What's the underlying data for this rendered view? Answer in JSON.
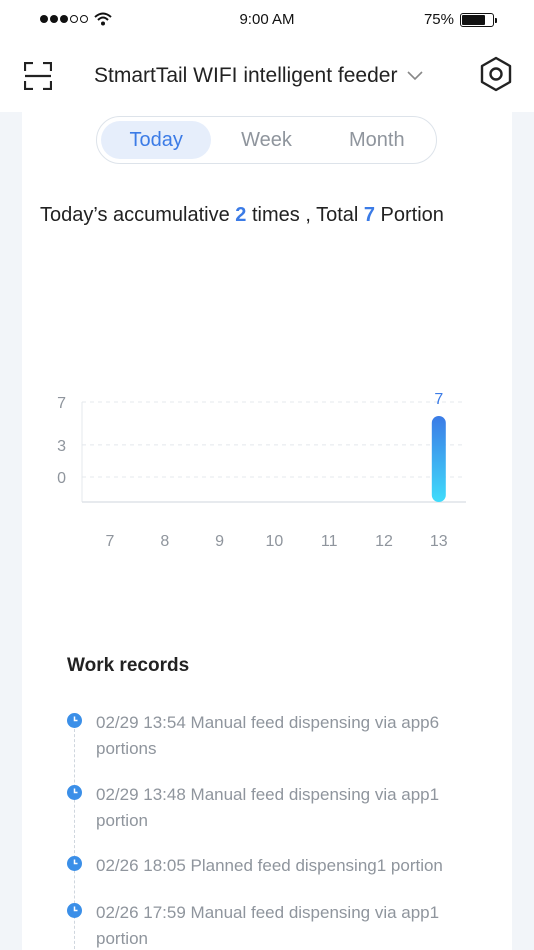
{
  "status_bar": {
    "time": "9:00 AM",
    "battery": "75%",
    "battery_level": 0.75
  },
  "header": {
    "title": "StmartTail WIFI intelligent feeder",
    "icons": [
      "scan-icon",
      "chevron-down-icon",
      "settings-icon"
    ]
  },
  "tabs": [
    {
      "label": "Today",
      "active": true
    },
    {
      "label": "Week",
      "active": false
    },
    {
      "label": "Month",
      "active": false
    }
  ],
  "summary": {
    "prefix": "Today’s accumulative ",
    "times": "2",
    "middle": " times , Total ",
    "portions": "7",
    "suffix": " Portion"
  },
  "chart_data": {
    "type": "bar",
    "categories": [
      "7",
      "8",
      "9",
      "10",
      "11",
      "12",
      "13"
    ],
    "values": [
      0,
      0,
      0,
      0,
      0,
      0,
      7
    ],
    "yticks": [
      0,
      3,
      7
    ],
    "ylim": [
      0,
      7
    ],
    "data_labels": [
      {
        "category": "13",
        "text": "7"
      }
    ],
    "title": "",
    "xlabel": "",
    "ylabel": "",
    "grid": true,
    "colors": {
      "bar_top": "#3b7be6",
      "bar_bottom": "#3fdcfb",
      "label": "#3b7be6",
      "axis_text": "#8f959d"
    }
  },
  "records": {
    "title": "Work records",
    "items": [
      {
        "text": "02/29 13:54 Manual feed dispensing via app6 portions"
      },
      {
        "text": "02/29 13:48 Manual feed dispensing via app1 portion"
      },
      {
        "text": "02/26 18:05 Planned feed dispensing1 portion"
      },
      {
        "text": "02/26 17:59 Manual feed dispensing via app1 portion"
      }
    ]
  },
  "colors": {
    "accent": "#3b7be6",
    "page_bg": "#f2f5f9",
    "muted_text": "#8f959d"
  }
}
